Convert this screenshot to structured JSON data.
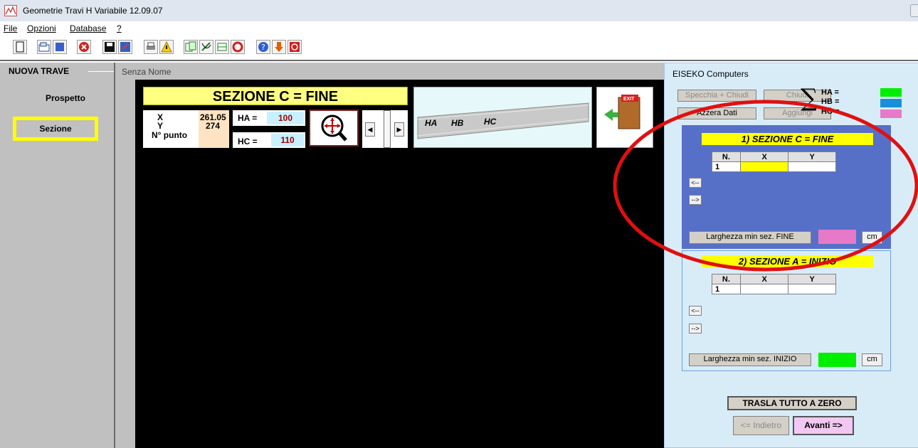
{
  "window": {
    "title": "Geometrie Travi H Variabile 12.09.07"
  },
  "menu": [
    {
      "label": "File"
    },
    {
      "label": "Opzioni"
    },
    {
      "label": "Database"
    },
    {
      "label": "?"
    }
  ],
  "toolbar": {
    "buttons": [
      "new-icon",
      "open-icon",
      "print-icon",
      "close-icon",
      "save-icon",
      "export-icon",
      "printer-icon",
      "warning-icon",
      "copy-icon",
      "draw-icon",
      "section-icon",
      "recycle-icon",
      "help-icon",
      "down-arrow-icon",
      "stop-icon"
    ]
  },
  "left_panel": {
    "title": "NUOVA TRAVE",
    "items": [
      {
        "label": "Prospetto",
        "selected": false
      },
      {
        "label": "Sezione",
        "selected": true
      }
    ]
  },
  "document": {
    "title": "Senza Nome"
  },
  "section_view": {
    "title": "SEZIONE C = FINE",
    "x_label": "X",
    "y_label": "Y",
    "point_label": "N° punto",
    "x_value": "261.05",
    "y_value": "274",
    "ha_label": "HA =",
    "ha_value": "100",
    "hc_label": "HC =",
    "hc_value": "110",
    "preview_labels": [
      "HA",
      "HB",
      "HC"
    ],
    "exit_label": "EXIT"
  },
  "right_panel": {
    "title": "EISEKO Computers",
    "buttons": {
      "mirror_close": "Specchia + Chiudi",
      "close": "Chiudi",
      "reset": "Azzera Dati",
      "add": "Aggiungi"
    },
    "legend": [
      {
        "label": "HA =",
        "color": "#00ee00"
      },
      {
        "label": "HB =",
        "color": "#1a8fd8"
      },
      {
        "label": "HC =",
        "color": "#e67ac8"
      }
    ],
    "section1": {
      "title": "1) SEZIONE C = FINE",
      "headers": [
        "N.",
        "X",
        "Y"
      ],
      "rows": [
        [
          "1",
          "",
          ""
        ]
      ],
      "nav_prev": "<--",
      "nav_next": "-->",
      "min_width_label": "Larghezza min sez. FINE",
      "unit": "cm",
      "color": "#e67ac8"
    },
    "section2": {
      "title": "2) SEZIONE A = INIZIO",
      "headers": [
        "N.",
        "X",
        "Y"
      ],
      "rows": [
        [
          "1",
          "",
          ""
        ]
      ],
      "nav_prev": "<--",
      "nav_next": "-->",
      "min_width_label": "Larghezza min sez. INIZIO",
      "unit": "cm",
      "color": "#00ee00"
    },
    "shift_button": "TRASLA TUTTO A ZERO",
    "back_button": "<= Indietro",
    "next_button": "Avanti =>"
  }
}
